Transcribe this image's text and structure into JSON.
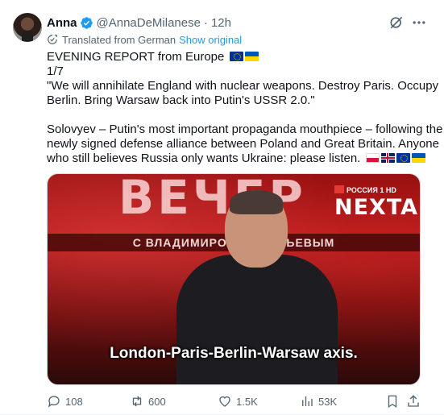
{
  "author": {
    "name": "Anna",
    "handle": "@AnnaDeMilanese",
    "separator": "·",
    "time": "12h"
  },
  "translation": {
    "label": "Translated from German",
    "show_original": "Show original"
  },
  "tweet_text": {
    "line1": "EVENING REPORT from Europe",
    "line2": "1/7",
    "line3": "\"We will annihilate England with nuclear weapons. Destroy Paris. Occupy",
    "line4": "Berlin. Bring Warsaw back into Putin's USSR 2.0.\"",
    "line5": "Solovyev – Putin's most important propaganda mouthpiece – following the",
    "line6": "newly signed defense alliance between Poland and Great Britain. Anyone",
    "line7": "who still believes Russia only wants Ukraine: please listen."
  },
  "media": {
    "studio_title": "ВЕЧЕР",
    "studio_subtitle": "С ВЛАДИМИРОМ СОЛОВЬЕВЫМ",
    "channel_label": "РОССИЯ 1 HD",
    "watermark": "NEXTA",
    "caption": "London-Paris-Berlin-Warsaw axis."
  },
  "metrics": {
    "replies": "108",
    "reposts": "600",
    "likes": "1.5K",
    "views": "53K"
  },
  "icons": {
    "verified": "verified-badge-icon",
    "grok": "grok-icon",
    "more": "more-icon",
    "translate": "translate-icon",
    "reply": "reply-icon",
    "repost": "repost-icon",
    "like": "heart-icon",
    "views": "views-icon",
    "bookmark": "bookmark-icon",
    "share": "share-icon"
  },
  "colors": {
    "accent": "#1d9bf0",
    "text": "#0f1419",
    "secondary": "#536471"
  }
}
